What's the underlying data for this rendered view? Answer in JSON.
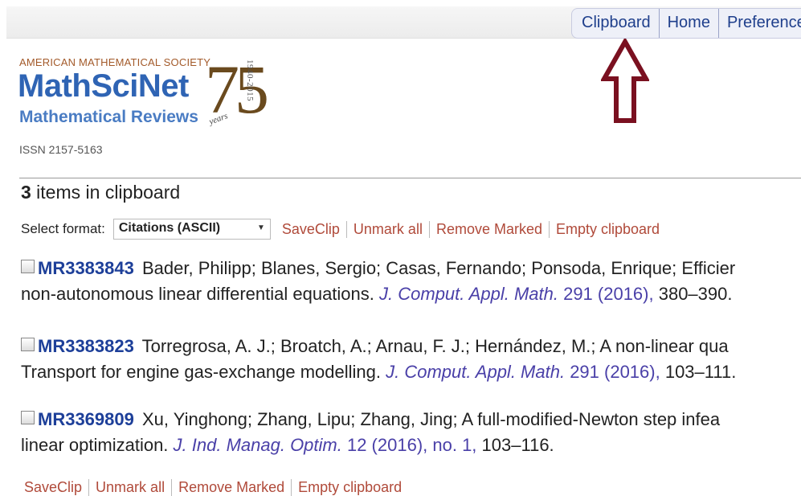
{
  "nav": {
    "tabs": [
      "Clipboard",
      "Home",
      "Preferences"
    ]
  },
  "logo": {
    "society": "AMERICAN MATHEMATICAL SOCIETY",
    "name": "MathSciNet",
    "subtitle": "Mathematical Reviews",
    "anniversary": "75",
    "years_word": "years",
    "years_range": "1940-2015"
  },
  "issn": "ISSN 2157-5163",
  "clipboard": {
    "count": "3",
    "count_text": " items in clipboard"
  },
  "format": {
    "label": "Select format:",
    "selected": "Citations (ASCII)"
  },
  "actions": [
    "SaveClip",
    "Unmark all",
    "Remove Marked",
    "Empty clipboard"
  ],
  "entries": [
    {
      "mr": "MR3383843",
      "authors": " Bader, Philipp; Blanes, Sergio; Casas, Fernando; Ponsoda, Enrique; Efficier",
      "line2": "non-autonomous linear differential equations. ",
      "journal": "J. Comput. Appl. Math.",
      "volume": " 291 (2016),",
      "pages": " 380–390."
    },
    {
      "mr": "MR3383823",
      "authors": " Torregrosa, A. J.; Broatch, A.; Arnau, F. J.; Hernández, M.; A non-linear qua",
      "line2": "Transport for engine gas-exchange modelling. ",
      "journal": "J. Comput. Appl. Math.",
      "volume": " 291 (2016),",
      "pages": " 103–111."
    },
    {
      "mr": "MR3369809",
      "authors": " Xu, Yinghong; Zhang, Lipu; Zhang, Jing; A full-modified-Newton step infea",
      "line2": "linear optimization. ",
      "journal": "J. Ind. Manag. Optim.",
      "volume": " 12 (2016), no. 1,",
      "pages": " 103–116."
    }
  ],
  "colors": {
    "link": "#b04a3a",
    "mr_number": "#1d3f99",
    "journal": "#4a40a8",
    "arrow": "#7a1020"
  }
}
